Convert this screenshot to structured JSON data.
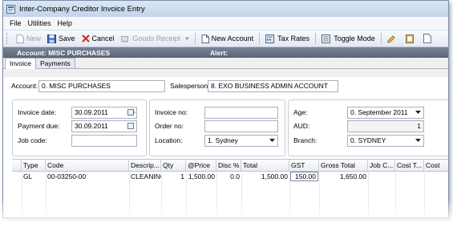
{
  "window": {
    "title": "Inter-Company Creditor Invoice Entry"
  },
  "menu": [
    "File",
    "Utilities",
    "Help"
  ],
  "toolbar": {
    "new": "New",
    "save": "Save",
    "cancel": "Cancel",
    "goods_receipt": "Goods Receipt",
    "new_account": "New Account",
    "tax_rates": "Tax Rates",
    "toggle_mode": "Toggle Mode"
  },
  "infobar": {
    "account": "Account: MISC PURCHASES",
    "alert": "Alert:"
  },
  "tabs": [
    "Invoice",
    "Payments"
  ],
  "header": {
    "account_label": "Account:",
    "account_value": "0. MISC PURCHASES",
    "salesperson_label": "Salesperson:",
    "salesperson_value": "8. EXO BUSINESS ADMIN ACCOUNT"
  },
  "dates": {
    "invoice_date_label": "Invoice date:",
    "invoice_date_value": "30.09.2011",
    "payment_due_label": "Payment due:",
    "payment_due_value": "30.09.2011",
    "job_code_label": "Job code:",
    "job_code_value": ""
  },
  "invoice": {
    "invoice_no_label": "Invoice no:",
    "invoice_no_value": "",
    "order_no_label": "Order no:",
    "order_no_value": "",
    "location_label": "Location:",
    "location_value": "1. Sydney"
  },
  "aging": {
    "age_label": "Age:",
    "age_value": "0. September 2011",
    "aud_label": "AUD:",
    "aud_value": "1",
    "branch_label": "Branch:",
    "branch_value": "0. SYDNEY"
  },
  "grid": {
    "columns": [
      "Type",
      "Code",
      "Descrip...",
      "Qty",
      "@Price",
      "Disc %",
      "Total",
      "GST",
      "Gross Total",
      "Job C...",
      "Cost T...",
      "Cost"
    ],
    "rows": [
      [
        "GL",
        "00-03250-00",
        "CLEANING",
        "1",
        "1,500.00",
        "0.0",
        "1,500.00",
        "150.00",
        "1,650.00",
        "",
        "",
        ""
      ]
    ]
  }
}
